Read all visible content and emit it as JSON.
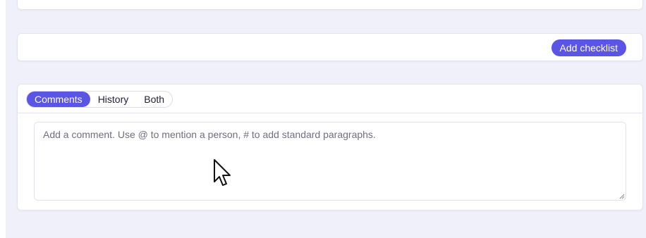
{
  "checklist": {
    "add_button_label": "Add checklist"
  },
  "activity": {
    "tabs": [
      {
        "label": "Comments",
        "active": true
      },
      {
        "label": "History",
        "active": false
      },
      {
        "label": "Both",
        "active": false
      }
    ],
    "comment_input": {
      "value": "",
      "placeholder": "Add a comment. Use @ to mention a person, # to add standard paragraphs."
    }
  },
  "colors": {
    "accent": "#5a55e4",
    "page_background": "#f0f0fb",
    "card_border": "#e4e4ee"
  },
  "icons": {
    "cursor": "mouse-pointer-icon",
    "resize": "resize-handle-icon"
  }
}
